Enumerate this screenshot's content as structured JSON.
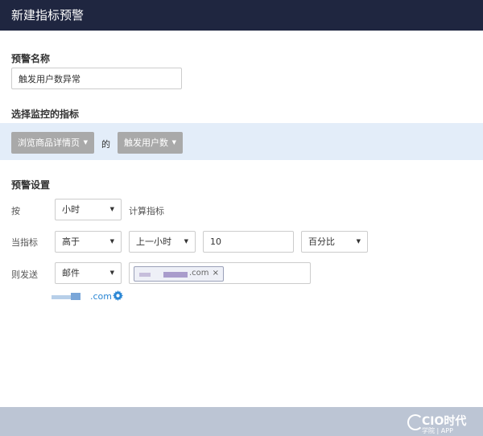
{
  "window": {
    "title": "新建指标预警"
  },
  "alert_name": {
    "label": "预警名称",
    "value": "触发用户数异常"
  },
  "metric": {
    "label": "选择监控的指标",
    "page_select": "浏览商品详情页",
    "connector": "的",
    "metric_select": "触发用户数"
  },
  "settings": {
    "label": "预警设置",
    "by": {
      "label": "按",
      "unit_select": "小时",
      "hint": "计算指标"
    },
    "condition": {
      "label": "当指标",
      "compare_select": "高于",
      "period_select": "上一小时",
      "threshold_value": "10",
      "type_select": "百分比"
    },
    "send": {
      "label": "则发送",
      "channel_select": "邮件",
      "recipient_suffix": ".com",
      "note_suffix": ".com"
    }
  },
  "watermark": {
    "line1": "CIO时代",
    "line2": "学院 | APP"
  },
  "icons": {
    "caret": "caret-down-icon",
    "remove": "close-icon",
    "settings": "gear-icon"
  },
  "colors": {
    "titlebar": "#1f2640",
    "band": "#e3edf9",
    "gray_select": "#a9a9a9",
    "link": "#2a86d4",
    "footer": "#bcc5d4"
  }
}
